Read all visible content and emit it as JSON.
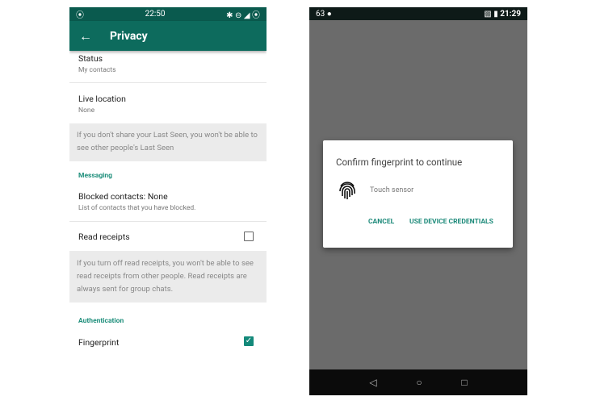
{
  "left_phone": {
    "status_bar": {
      "time": "22:50",
      "left_icon": "record-icon",
      "right_icons": "✱ ⊖ ◢ ⦿"
    },
    "toolbar": {
      "back_icon": "←",
      "title": "Privacy"
    },
    "items": [
      {
        "title": "Status",
        "subtitle": "My contacts"
      },
      {
        "title": "Live location",
        "subtitle": "None"
      }
    ],
    "last_seen_note": "If you don't share your Last Seen, you won't be able to see other people's Last Seen",
    "messaging_header": "Messaging",
    "blocked": {
      "title": "Blocked contacts: None",
      "subtitle": "List of contacts that you have blocked."
    },
    "read_receipts": {
      "title": "Read receipts",
      "checked": false
    },
    "read_receipts_note": "If you turn off read receipts, you won't be able to see read receipts from other people. Read receipts are always sent for group chats.",
    "authentication_header": "Authentication",
    "fingerprint": {
      "title": "Fingerprint",
      "checked": true
    }
  },
  "right_phone": {
    "status_bar": {
      "left": "63 ●",
      "time": "21:29",
      "right_icons": "▧ ▮"
    },
    "dialog": {
      "title": "Confirm fingerprint to continue",
      "icon": "fingerprint-icon",
      "sensor_label": "Touch sensor",
      "cancel": "CANCEL",
      "use_credentials": "USE DEVICE CREDENTIALS"
    },
    "nav": {
      "back": "◁",
      "home": "○",
      "recents": "□"
    }
  }
}
